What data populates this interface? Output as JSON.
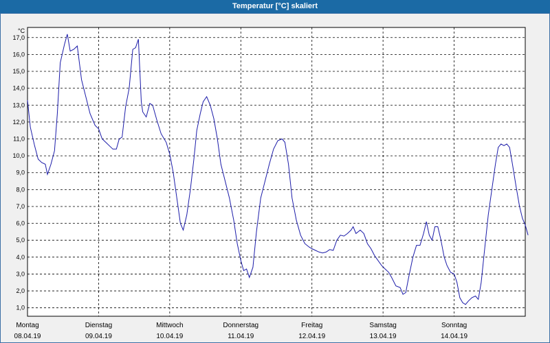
{
  "window": {
    "title": "Temperatur [°C] skaliert"
  },
  "colors": {
    "title_bar": "#1b6aa5",
    "line": "#1a1aa8",
    "grid": "#000000",
    "background": "#f0f0f0"
  },
  "chart_data": {
    "type": "line",
    "title": "Temperatur [°C] skaliert",
    "unit_label": "°C",
    "grid": true,
    "xlabel": "",
    "ylabel": "",
    "ylim": [
      0.5,
      17.6
    ],
    "y_ticks": [
      "1,0",
      "2,0",
      "3,0",
      "4,0",
      "5,0",
      "6,0",
      "7,0",
      "8,0",
      "9,0",
      "10,0",
      "11,0",
      "12,0",
      "13,0",
      "14,0",
      "15,0",
      "16,0",
      "17,0"
    ],
    "day_labels": [
      {
        "day": "Montag",
        "date": "08.04.19"
      },
      {
        "day": "Dienstag",
        "date": "09.04.19"
      },
      {
        "day": "Mittwoch",
        "date": "10.04.19"
      },
      {
        "day": "Donnerstag",
        "date": "11.04.19"
      },
      {
        "day": "Freitag",
        "date": "12.04.19"
      },
      {
        "day": "Samstag",
        "date": "13.04.19"
      },
      {
        "day": "Sonntag",
        "date": "14.04.19"
      }
    ],
    "x_unit": "days from 08.04.19 00:00",
    "series": [
      {
        "values": [
          [
            0.0,
            13.3
          ],
          [
            0.04,
            11.7
          ],
          [
            0.1,
            10.6
          ],
          [
            0.15,
            9.8
          ],
          [
            0.2,
            9.6
          ],
          [
            0.25,
            9.5
          ],
          [
            0.28,
            8.9
          ],
          [
            0.33,
            9.5
          ],
          [
            0.38,
            10.3
          ],
          [
            0.42,
            12.5
          ],
          [
            0.46,
            15.5
          ],
          [
            0.52,
            16.6
          ],
          [
            0.56,
            17.2
          ],
          [
            0.6,
            16.2
          ],
          [
            0.65,
            16.3
          ],
          [
            0.7,
            16.5
          ],
          [
            0.76,
            14.5
          ],
          [
            0.82,
            13.5
          ],
          [
            0.88,
            12.5
          ],
          [
            0.95,
            11.8
          ],
          [
            1.0,
            11.6
          ],
          [
            1.05,
            11.0
          ],
          [
            1.1,
            10.8
          ],
          [
            1.15,
            10.6
          ],
          [
            1.2,
            10.4
          ],
          [
            1.25,
            10.4
          ],
          [
            1.29,
            11.0
          ],
          [
            1.33,
            11.1
          ],
          [
            1.38,
            12.9
          ],
          [
            1.43,
            14.0
          ],
          [
            1.48,
            16.3
          ],
          [
            1.52,
            16.4
          ],
          [
            1.56,
            16.9
          ],
          [
            1.6,
            13.2
          ],
          [
            1.62,
            12.6
          ],
          [
            1.67,
            12.3
          ],
          [
            1.72,
            13.1
          ],
          [
            1.76,
            13.0
          ],
          [
            1.82,
            12.1
          ],
          [
            1.88,
            11.3
          ],
          [
            1.95,
            10.8
          ],
          [
            2.0,
            10.1
          ],
          [
            2.05,
            9.0
          ],
          [
            2.1,
            7.5
          ],
          [
            2.15,
            6.0
          ],
          [
            2.19,
            5.6
          ],
          [
            2.24,
            6.5
          ],
          [
            2.29,
            8.0
          ],
          [
            2.34,
            9.8
          ],
          [
            2.38,
            11.5
          ],
          [
            2.43,
            12.5
          ],
          [
            2.47,
            13.2
          ],
          [
            2.52,
            13.5
          ],
          [
            2.57,
            13.0
          ],
          [
            2.62,
            12.2
          ],
          [
            2.67,
            11.0
          ],
          [
            2.72,
            9.5
          ],
          [
            2.78,
            8.5
          ],
          [
            2.84,
            7.5
          ],
          [
            2.9,
            6.2
          ],
          [
            2.95,
            4.8
          ],
          [
            3.0,
            3.8
          ],
          [
            3.04,
            3.2
          ],
          [
            3.08,
            3.3
          ],
          [
            3.12,
            2.8
          ],
          [
            3.17,
            3.4
          ],
          [
            3.22,
            5.5
          ],
          [
            3.28,
            7.5
          ],
          [
            3.34,
            8.5
          ],
          [
            3.4,
            9.5
          ],
          [
            3.46,
            10.4
          ],
          [
            3.52,
            10.9
          ],
          [
            3.58,
            11.0
          ],
          [
            3.62,
            10.8
          ],
          [
            3.67,
            9.5
          ],
          [
            3.72,
            7.5
          ],
          [
            3.78,
            6.2
          ],
          [
            3.84,
            5.3
          ],
          [
            3.9,
            4.8
          ],
          [
            3.96,
            4.6
          ],
          [
            4.0,
            4.5
          ],
          [
            4.05,
            4.4
          ],
          [
            4.1,
            4.3
          ],
          [
            4.15,
            4.25
          ],
          [
            4.2,
            4.3
          ],
          [
            4.25,
            4.45
          ],
          [
            4.3,
            4.4
          ],
          [
            4.35,
            5.0
          ],
          [
            4.4,
            5.3
          ],
          [
            4.45,
            5.25
          ],
          [
            4.5,
            5.4
          ],
          [
            4.55,
            5.6
          ],
          [
            4.58,
            5.8
          ],
          [
            4.62,
            5.4
          ],
          [
            4.68,
            5.6
          ],
          [
            4.73,
            5.4
          ],
          [
            4.78,
            4.8
          ],
          [
            4.83,
            4.5
          ],
          [
            4.88,
            4.1
          ],
          [
            4.93,
            3.8
          ],
          [
            4.98,
            3.5
          ],
          [
            5.03,
            3.3
          ],
          [
            5.08,
            3.1
          ],
          [
            5.12,
            2.8
          ],
          [
            5.18,
            2.3
          ],
          [
            5.24,
            2.2
          ],
          [
            5.28,
            1.8
          ],
          [
            5.32,
            1.9
          ],
          [
            5.36,
            2.8
          ],
          [
            5.42,
            4.0
          ],
          [
            5.47,
            4.7
          ],
          [
            5.52,
            4.7
          ],
          [
            5.57,
            5.4
          ],
          [
            5.61,
            6.1
          ],
          [
            5.65,
            5.3
          ],
          [
            5.69,
            5.0
          ],
          [
            5.73,
            5.8
          ],
          [
            5.77,
            5.8
          ],
          [
            5.81,
            5.1
          ],
          [
            5.86,
            4.0
          ],
          [
            5.9,
            3.5
          ],
          [
            5.95,
            3.1
          ],
          [
            6.0,
            3.0
          ],
          [
            6.04,
            2.5
          ],
          [
            6.08,
            1.6
          ],
          [
            6.12,
            1.3
          ],
          [
            6.16,
            1.2
          ],
          [
            6.2,
            1.4
          ],
          [
            6.25,
            1.6
          ],
          [
            6.3,
            1.7
          ],
          [
            6.34,
            1.5
          ],
          [
            6.38,
            2.5
          ],
          [
            6.43,
            4.5
          ],
          [
            6.48,
            6.5
          ],
          [
            6.53,
            8.0
          ],
          [
            6.58,
            9.5
          ],
          [
            6.62,
            10.5
          ],
          [
            6.66,
            10.7
          ],
          [
            6.7,
            10.6
          ],
          [
            6.74,
            10.7
          ],
          [
            6.78,
            10.5
          ],
          [
            6.82,
            9.5
          ],
          [
            6.87,
            8.2
          ],
          [
            6.92,
            7.0
          ],
          [
            6.96,
            6.3
          ],
          [
            7.0,
            5.9
          ],
          [
            7.04,
            5.3
          ]
        ]
      }
    ]
  }
}
